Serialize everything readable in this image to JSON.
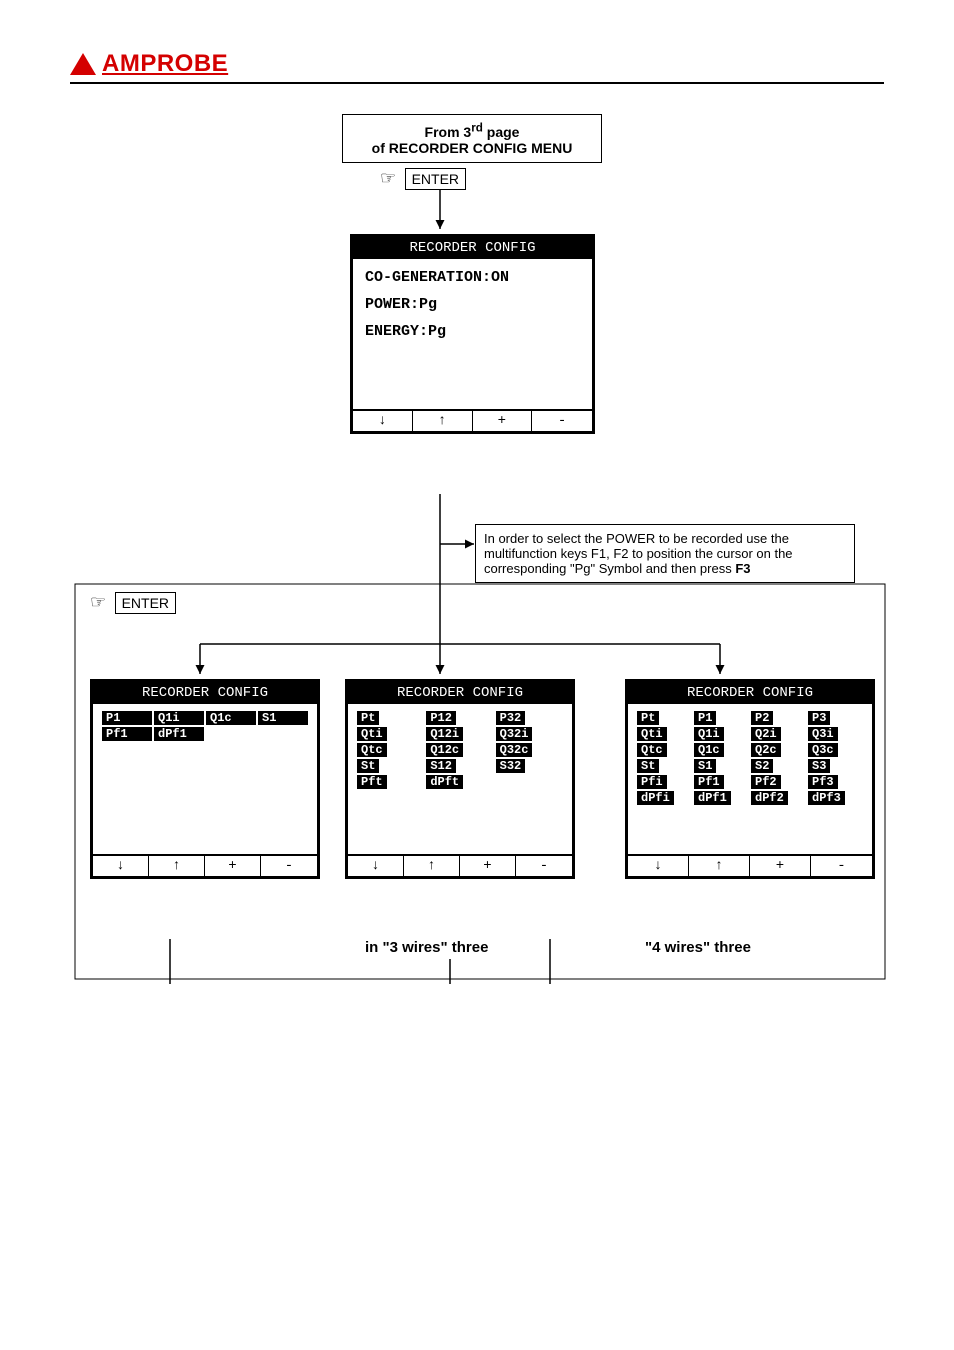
{
  "brand": "AMPROBE",
  "top_hint_line1": "From 3",
  "top_hint_sup": "rd",
  "top_hint_line1b": " page",
  "top_hint_line2": "of RECORDER CONFIG MENU",
  "enter_label": "ENTER",
  "main_screen": {
    "title": "RECORDER CONFIG",
    "line1": "CO-GENERATION:ON",
    "line2": "POWER:Pg",
    "line3": "ENERGY:Pg",
    "fn": [
      "↓",
      "↑",
      "+",
      "-"
    ]
  },
  "note_line1": "In order to select the POWER to be recorded use the",
  "note_line2": "multifunction keys F1, F2 to position the cursor on the",
  "note_line3_a": "corresponding \"Pg\" Symbol and then press ",
  "note_line3_b": "F3",
  "screen_left": {
    "title": "RECORDER CONFIG",
    "row1": [
      "P1",
      "Q1i",
      "Q1c",
      "S1"
    ],
    "row2": [
      "Pf1",
      "dPf1"
    ],
    "fn": [
      "↓",
      "↑",
      "+",
      "-"
    ]
  },
  "screen_mid": {
    "title": "RECORDER CONFIG",
    "col1": [
      "Pt",
      "Qti",
      "Qtc",
      "St",
      "Pft"
    ],
    "col2": [
      "P12",
      "Q12i",
      "Q12c",
      "S12",
      "dPft"
    ],
    "col3": [
      "P32",
      "Q32i",
      "Q32c",
      "S32"
    ],
    "fn": [
      "↓",
      "↑",
      "+",
      "-"
    ]
  },
  "screen_right": {
    "title": "RECORDER CONFIG",
    "col1": [
      "Pt",
      "Qti",
      "Qtc",
      "St",
      "Pfi",
      "dPfi"
    ],
    "col2": [
      "P1",
      "Q1i",
      "Q1c",
      "S1",
      "Pf1",
      "dPf1"
    ],
    "col3": [
      "P2",
      "Q2i",
      "Q2c",
      "S2",
      "Pf2",
      "dPf2"
    ],
    "col4": [
      "P3",
      "Q3i",
      "Q3c",
      "S3",
      "Pf3",
      "dPf3"
    ],
    "fn": [
      "↓",
      "↑",
      "+",
      "-"
    ]
  },
  "caption_mid": "in \"3 wires\" three",
  "caption_right": "\"4 wires\" three"
}
